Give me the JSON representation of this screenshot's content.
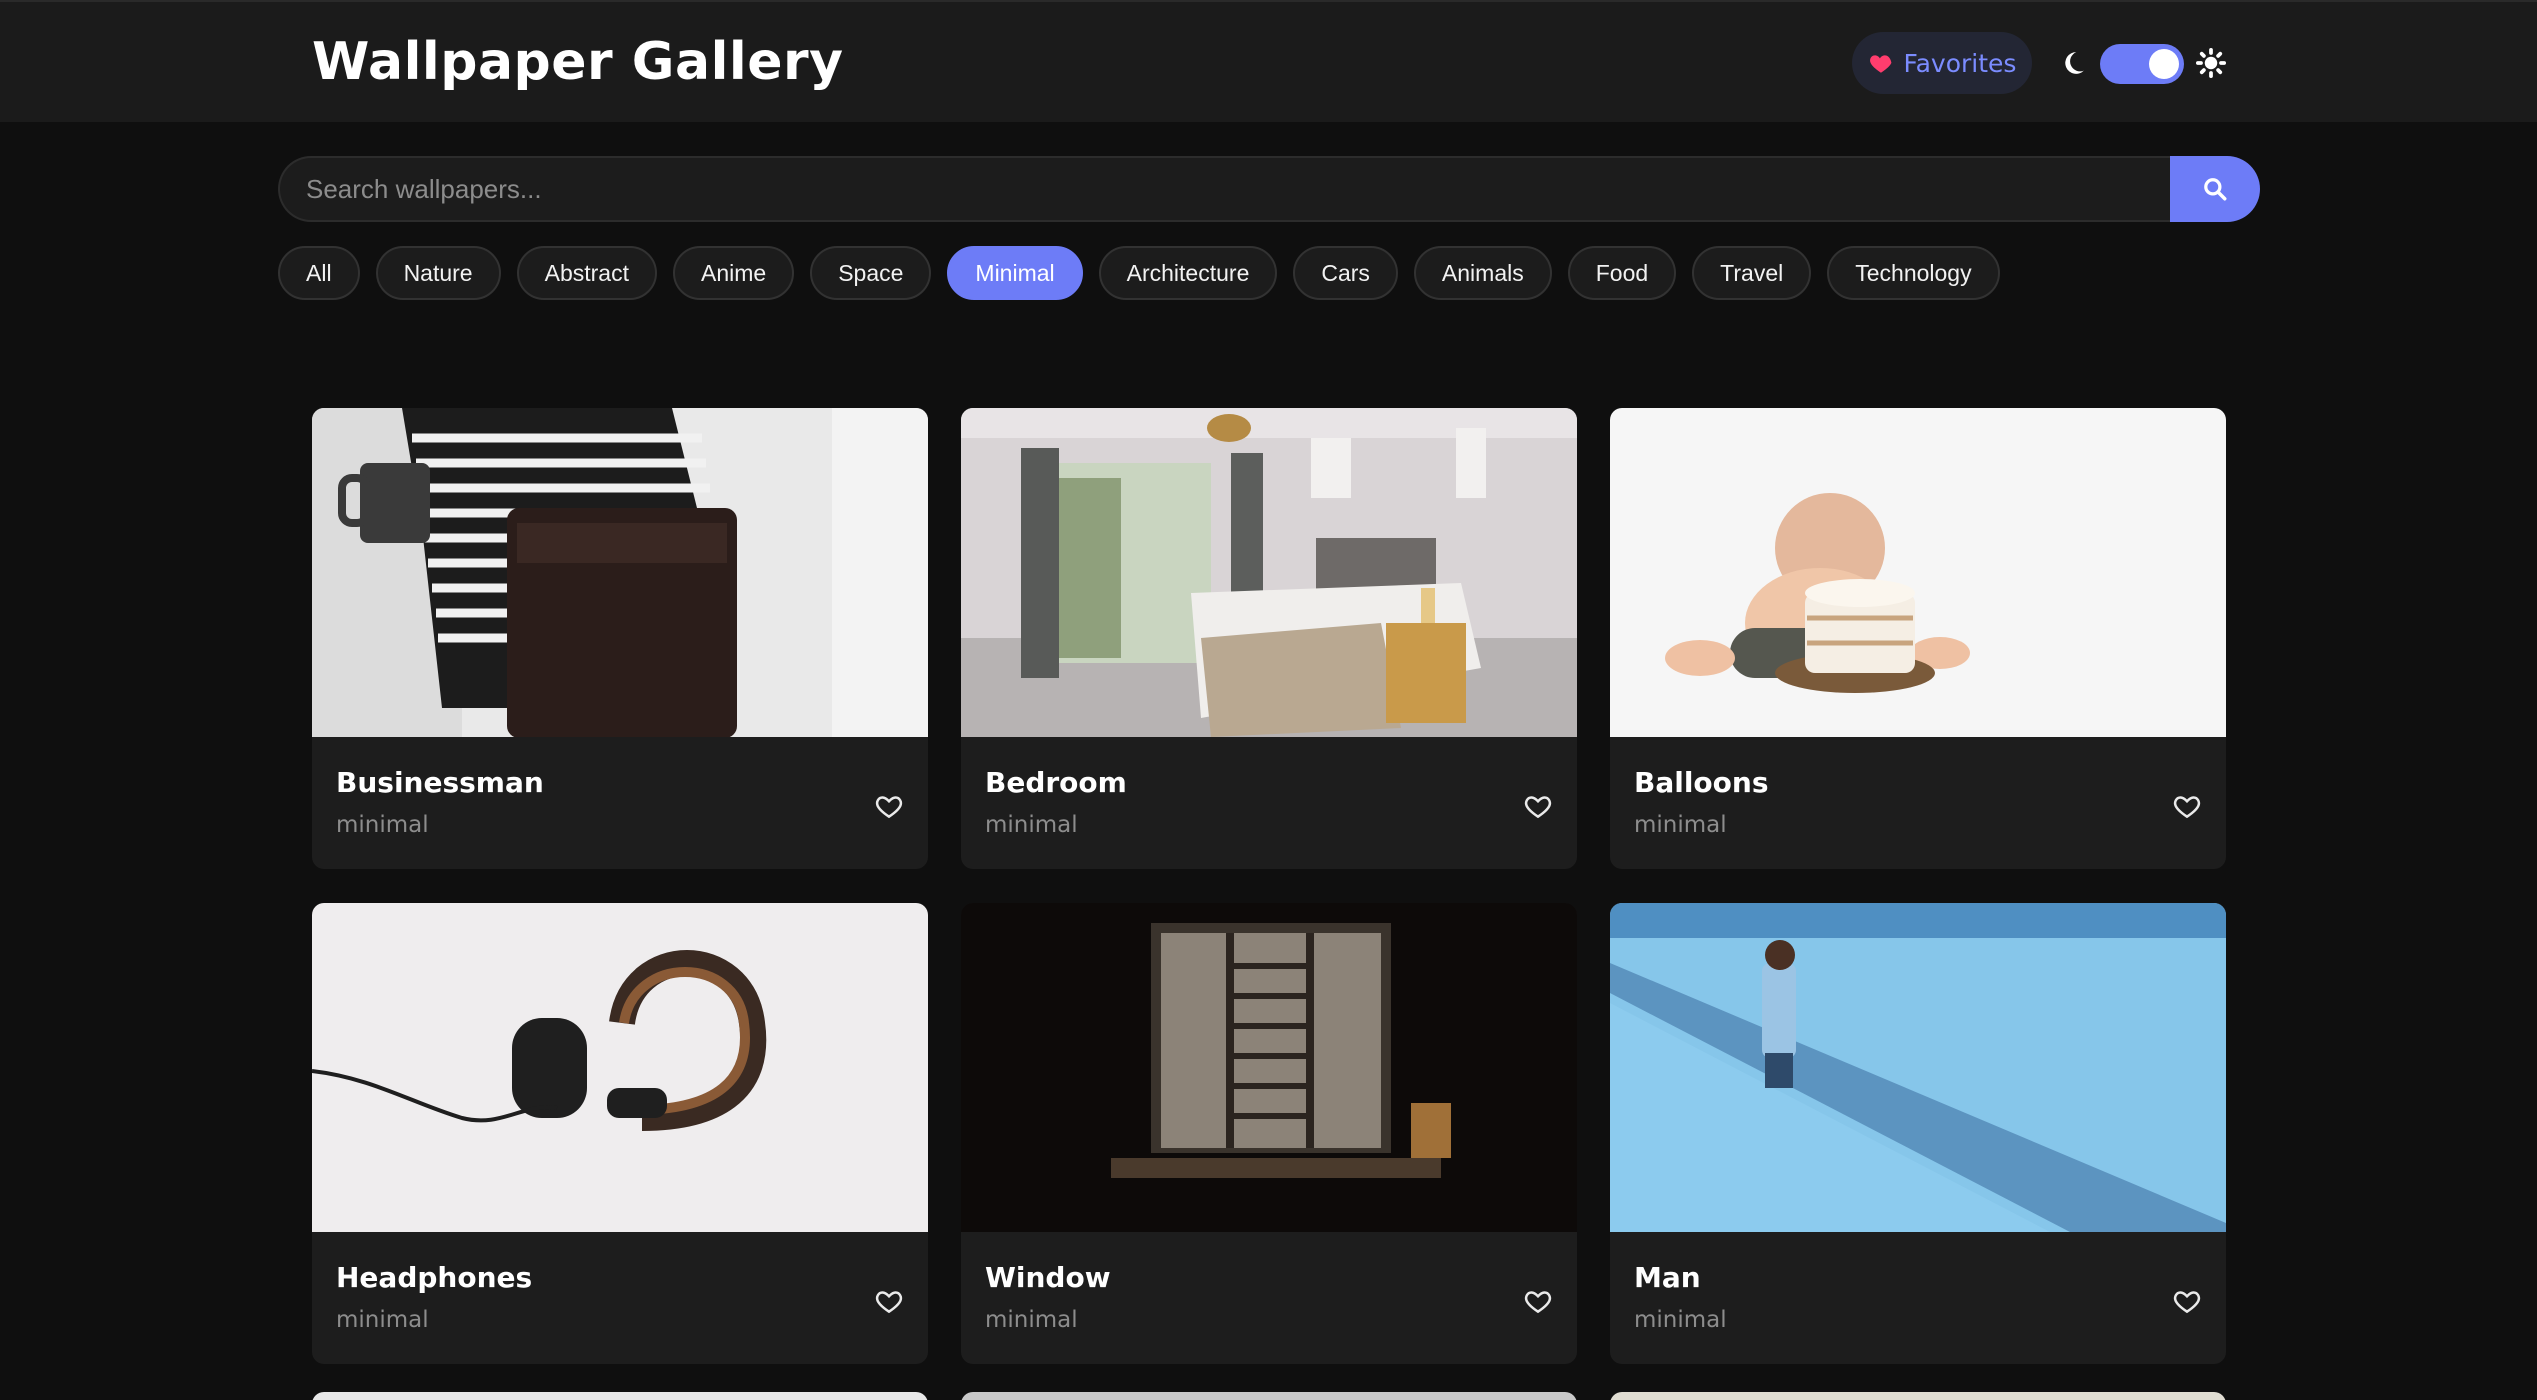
{
  "header": {
    "title": "Wallpaper Gallery",
    "favorites_label": "Favorites",
    "colors": {
      "accent": "#6d7cf7",
      "heart": "#ff3d6e"
    }
  },
  "search": {
    "placeholder": "Search wallpapers...",
    "value": ""
  },
  "categories": [
    {
      "label": "All",
      "active": false
    },
    {
      "label": "Nature",
      "active": false
    },
    {
      "label": "Abstract",
      "active": false
    },
    {
      "label": "Anime",
      "active": false
    },
    {
      "label": "Space",
      "active": false
    },
    {
      "label": "Minimal",
      "active": true
    },
    {
      "label": "Architecture",
      "active": false
    },
    {
      "label": "Cars",
      "active": false
    },
    {
      "label": "Animals",
      "active": false
    },
    {
      "label": "Food",
      "active": false
    },
    {
      "label": "Travel",
      "active": false
    },
    {
      "label": "Technology",
      "active": false
    }
  ],
  "wallpapers": [
    {
      "title": "Businessman",
      "category": "minimal",
      "favorited": false
    },
    {
      "title": "Bedroom",
      "category": "minimal",
      "favorited": false
    },
    {
      "title": "Balloons",
      "category": "minimal",
      "favorited": false
    },
    {
      "title": "Headphones",
      "category": "minimal",
      "favorited": false
    },
    {
      "title": "Window",
      "category": "minimal",
      "favorited": false
    },
    {
      "title": "Man",
      "category": "minimal",
      "favorited": false
    }
  ]
}
